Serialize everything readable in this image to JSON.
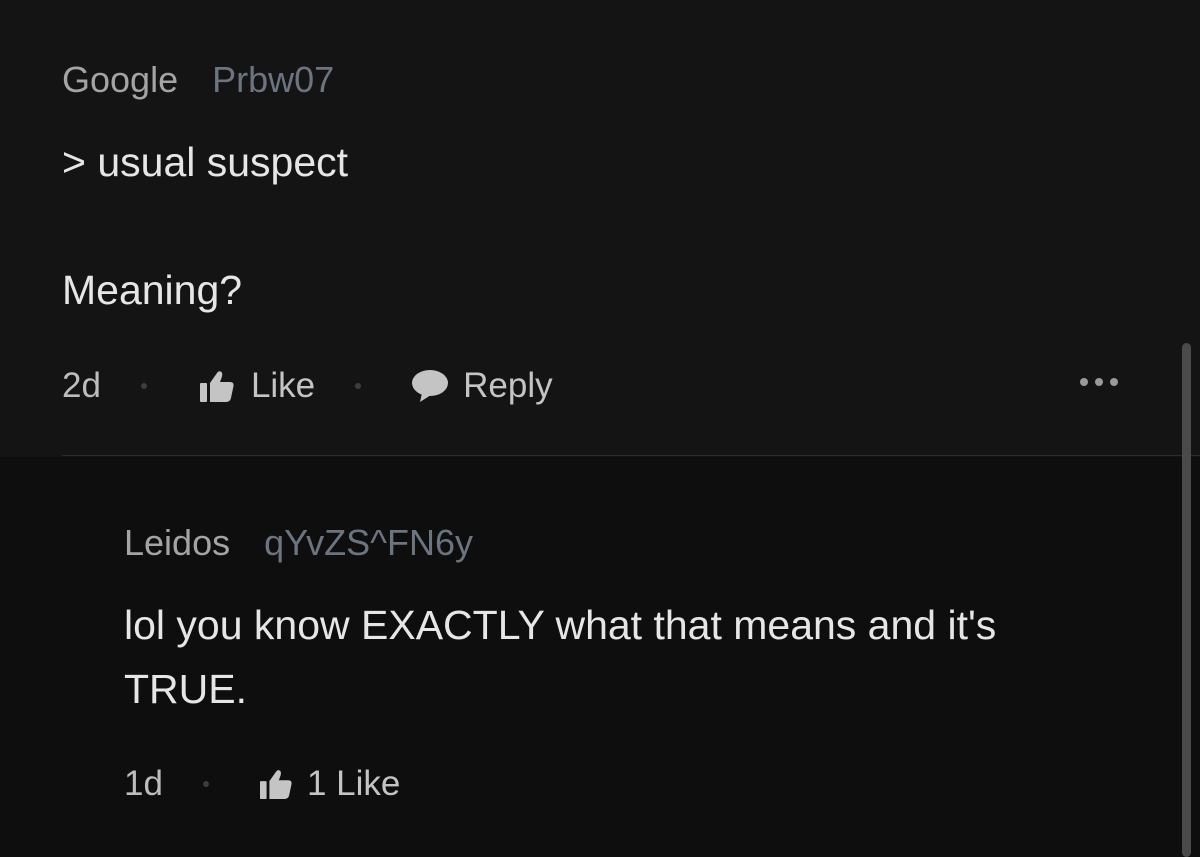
{
  "comments": [
    {
      "company": "Google",
      "handle": "Prbw07",
      "quote_line": "> usual suspect",
      "text": "Meaning?",
      "time": "2d",
      "like_label": "Like",
      "reply_label": "Reply"
    },
    {
      "company": "Leidos",
      "handle": "qYvZS^FN6y",
      "text_line1": "lol you know EXACTLY what that means and it's",
      "text_line2": "TRUE.",
      "time": "1d",
      "like_label": "1 Like"
    }
  ],
  "icons": {
    "like": "thumbs-up-icon",
    "reply": "speech-bubble-icon",
    "more": "more-options-icon"
  },
  "colors": {
    "background": "#141414",
    "reply_background": "#0e0e0e",
    "company": "#a4a4a4",
    "handle": "#6c7480",
    "text": "#e6e6e6"
  }
}
